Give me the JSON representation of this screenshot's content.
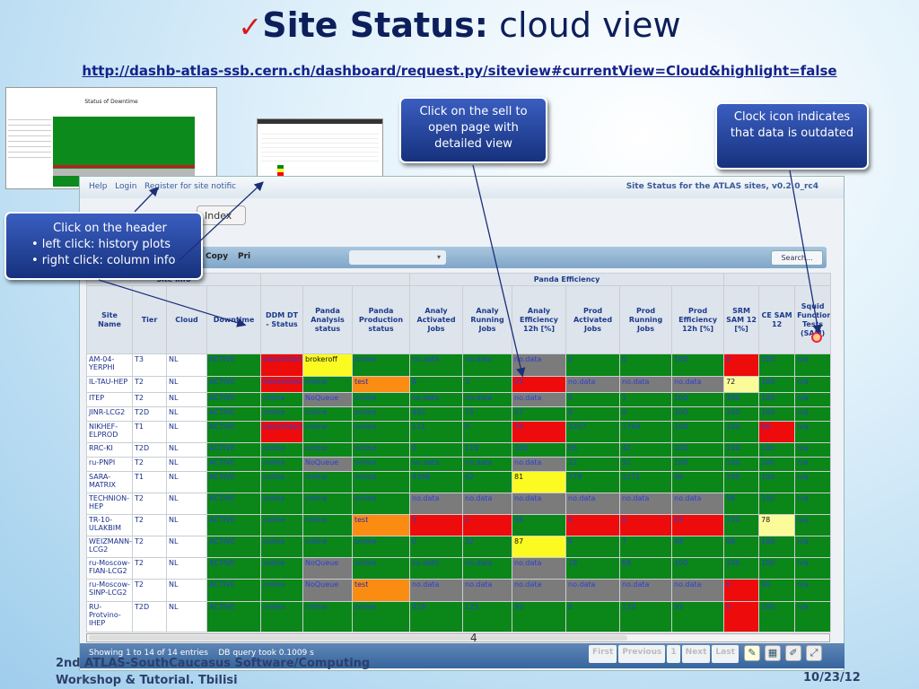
{
  "slide": {
    "title_bold": "Site Status:",
    "title_rest": "cloud view",
    "url": "http://dashb-atlas-ssb.cern.ch/dashboard/request.py/siteview#currentView=Cloud&highlight=false",
    "page_number": "4",
    "credit_line1": "2nd ATLAS-SouthCaucasus Software/Computing",
    "credit_line2": "Workshop & Tutorial. Tbilisi",
    "date": "10/23/12"
  },
  "thumb1": {
    "title": "Status of Downtime"
  },
  "callouts": {
    "cell": "Click on the sell to open page with detailed view",
    "clock": "Clock icon indicates that data is outdated",
    "header_title": "Click on the header",
    "header_items": [
      "•  left click: history plots",
      "•  right click: column info"
    ]
  },
  "dashboard": {
    "help": "Help",
    "login": "Login",
    "register": "Register for site notific",
    "version_title": "Site Status for the ATLAS sites, v0.2.0_rc4",
    "index": "Index",
    "copy": "Copy",
    "print": "Pri",
    "search": "Search..."
  },
  "table": {
    "groups": [
      "Site Info",
      "Panda Efficiency"
    ],
    "headers": [
      "Site Name",
      "Tier",
      "Cloud",
      "Downtime",
      "DDM DT - Status",
      "Panda Analysis status",
      "Panda Production status",
      "Analy Activated Jobs",
      "Analy Running Jobs",
      "Analy Efficiency 12h [%]",
      "Prod Activated Jobs",
      "Prod Running Jobs",
      "Prod Efficiency 12h [%]",
      "SRM SAM 12 [%]",
      "CE SAM 12",
      "Squid Functional Tests (SAM)"
    ],
    "rows": [
      {
        "cells": [
          "AM-04-YERPHI",
          "T3",
          "NL",
          "ACTIVE",
          "blacklisted",
          "brokeroff",
          "online",
          "no.data",
          "no.data",
          "no.data",
          "0",
          "0",
          "100",
          "0",
          "100",
          "n/a"
        ],
        "colors": [
          "txt",
          "txt",
          "txt",
          "G",
          "R",
          "Y",
          "G",
          "G",
          "G",
          "Gr",
          "G",
          "G",
          "G",
          "R",
          "G",
          "G"
        ]
      },
      {
        "cells": [
          "IL-TAU-HEP",
          "T2",
          "NL",
          "ACTIVE",
          "blacklisted",
          "online",
          "test",
          "8",
          "3",
          "25",
          "no.data",
          "no.data",
          "no.data",
          "72",
          "100",
          "n/a"
        ],
        "colors": [
          "txt",
          "txt",
          "txt",
          "G",
          "R",
          "G",
          "O",
          "G",
          "G",
          "R",
          "Gr",
          "Gr",
          "Gr",
          "Ly",
          "G",
          "G"
        ]
      },
      {
        "cells": [
          "ITEP",
          "T2",
          "NL",
          "ACTIVE",
          "online",
          "NoQueue",
          "online",
          "no.data",
          "no.data",
          "no.data",
          "6",
          "1",
          "100",
          "100",
          "100",
          "n/a"
        ],
        "colors": [
          "txt",
          "txt",
          "txt",
          "G",
          "G",
          "Gr",
          "G",
          "G",
          "G",
          "Gr",
          "G",
          "G",
          "G",
          "G",
          "G",
          "G"
        ]
      },
      {
        "cells": [
          "JINR-LCG2",
          "T2D",
          "NL",
          "ACTIVE",
          "online",
          "online",
          "online",
          "492",
          "75",
          "97",
          "0",
          "9",
          "100",
          "100",
          "100",
          "n/a"
        ],
        "colors": [
          "txt",
          "txt",
          "txt",
          "G",
          "G",
          "G",
          "G",
          "G",
          "G",
          "G",
          "G",
          "G",
          "G",
          "G",
          "G",
          "G"
        ]
      },
      {
        "cells": [
          "NIKHEF-ELPROD",
          "T1",
          "NL",
          "ACTIVE",
          "blacklisted",
          "online",
          "online",
          "121",
          "0",
          "79",
          "2357",
          "1764",
          "100",
          "100",
          "60",
          "n/a"
        ],
        "colors": [
          "txt",
          "txt",
          "txt",
          "G",
          "R",
          "G",
          "G",
          "G",
          "G",
          "R",
          "G",
          "G",
          "G",
          "G",
          "R",
          "G"
        ]
      },
      {
        "cells": [
          "RRC-KI",
          "T2D",
          "NL",
          "ACTIVE",
          "online",
          "online",
          "online",
          "0",
          "119",
          "100",
          "66",
          "42",
          "100",
          "100",
          "100",
          "n/a"
        ],
        "colors": [
          "txt",
          "txt",
          "txt",
          "G",
          "G",
          "G",
          "G",
          "G",
          "G",
          "G",
          "G",
          "G",
          "G",
          "G",
          "G",
          "G"
        ]
      },
      {
        "cells": [
          "ru-PNPI",
          "T2",
          "NL",
          "ACTIVE",
          "online",
          "NoQueue",
          "online",
          "no.data",
          "no.data",
          "no.data",
          "32",
          "52",
          "100",
          "100",
          "100",
          "n/a"
        ],
        "colors": [
          "txt",
          "txt",
          "txt",
          "G",
          "G",
          "Gr",
          "G",
          "G",
          "G",
          "Gr",
          "G",
          "G",
          "G",
          "G",
          "G",
          "G"
        ]
      },
      {
        "cells": [
          "SARA-MATRIX",
          "T1",
          "NL",
          "ACTIVE",
          "online",
          "online",
          "online",
          "4398",
          "62",
          "81",
          "779",
          "1271",
          "96",
          "100",
          "100",
          "n/a"
        ],
        "colors": [
          "txt",
          "txt",
          "txt",
          "G",
          "G",
          "G",
          "G",
          "G",
          "G",
          "Y",
          "G",
          "G",
          "G",
          "G",
          "G",
          "G"
        ]
      },
      {
        "cells": [
          "TECHNION-HEP",
          "T2",
          "NL",
          "ACTIVE",
          "online",
          "online",
          "online",
          "no.data",
          "no.data",
          "no.data",
          "no.data",
          "no.data",
          "no.data",
          "98",
          "100",
          "n/a"
        ],
        "colors": [
          "txt",
          "txt",
          "txt",
          "G",
          "G",
          "G",
          "G",
          "Gr",
          "Gr",
          "Gr",
          "Gr",
          "Gr",
          "Gr",
          "G",
          "G",
          "G"
        ]
      },
      {
        "cells": [
          "TR-10-ULAKBIM",
          "T2",
          "NL",
          "ACTIVE",
          "online",
          "online",
          "test",
          "3",
          "2",
          "98",
          "6",
          "0",
          "65",
          "100",
          "78",
          "n/a"
        ],
        "colors": [
          "txt",
          "txt",
          "txt",
          "G",
          "G",
          "G",
          "O",
          "R",
          "R",
          "G",
          "R",
          "R",
          "R",
          "G",
          "Ly",
          "G"
        ]
      },
      {
        "cells": [
          "WEIZMANN-LCG2",
          "T2",
          "NL",
          "ACTIVE",
          "online",
          "online",
          "online",
          "0",
          "32",
          "87",
          "4",
          "7",
          "98",
          "98",
          "100",
          "n/a"
        ],
        "colors": [
          "txt",
          "txt",
          "txt",
          "G",
          "G",
          "G",
          "G",
          "G",
          "G",
          "Y",
          "G",
          "G",
          "G",
          "G",
          "G",
          "G"
        ]
      },
      {
        "cells": [
          "ru-Moscow-FIAN-LCG2",
          "T2",
          "NL",
          "ACTIVE",
          "online",
          "NoQueue",
          "online",
          "no.data",
          "no.data",
          "no.data",
          "18",
          "68",
          "100",
          "100",
          "100",
          "n/a"
        ],
        "colors": [
          "txt",
          "txt",
          "txt",
          "G",
          "G",
          "Gr",
          "G",
          "G",
          "G",
          "Gr",
          "G",
          "G",
          "G",
          "G",
          "G",
          "G"
        ]
      },
      {
        "cells": [
          "ru-Moscow-SINP-LCG2",
          "T2",
          "NL",
          "ACTIVE",
          "online",
          "NoQueue",
          "test",
          "no.data",
          "no.data",
          "no.data",
          "no.data",
          "no.data",
          "no.data",
          "0",
          "90",
          "n/a"
        ],
        "colors": [
          "txt",
          "txt",
          "txt",
          "G",
          "G",
          "Gr",
          "O",
          "Gr",
          "Gr",
          "Gr",
          "Gr",
          "Gr",
          "Gr",
          "R",
          "G",
          "G"
        ]
      },
      {
        "cells": [
          "RU-Protvino-IHEP",
          "T2D",
          "NL",
          "ACTIVE",
          "online",
          "online",
          "online",
          "428",
          "125",
          "93",
          "8",
          "120",
          "93",
          "0",
          "100",
          "n/a"
        ],
        "colors": [
          "txt",
          "txt",
          "txt",
          "G",
          "G",
          "G",
          "G",
          "G",
          "G",
          "G",
          "G",
          "G",
          "G",
          "R",
          "G",
          "G"
        ]
      }
    ]
  },
  "footer": {
    "entries": "Showing 1 to 14 of 14 entries",
    "query": "DB query took 0.1009 s",
    "pager": [
      "First",
      "Previous",
      "1",
      "Next",
      "Last"
    ]
  }
}
